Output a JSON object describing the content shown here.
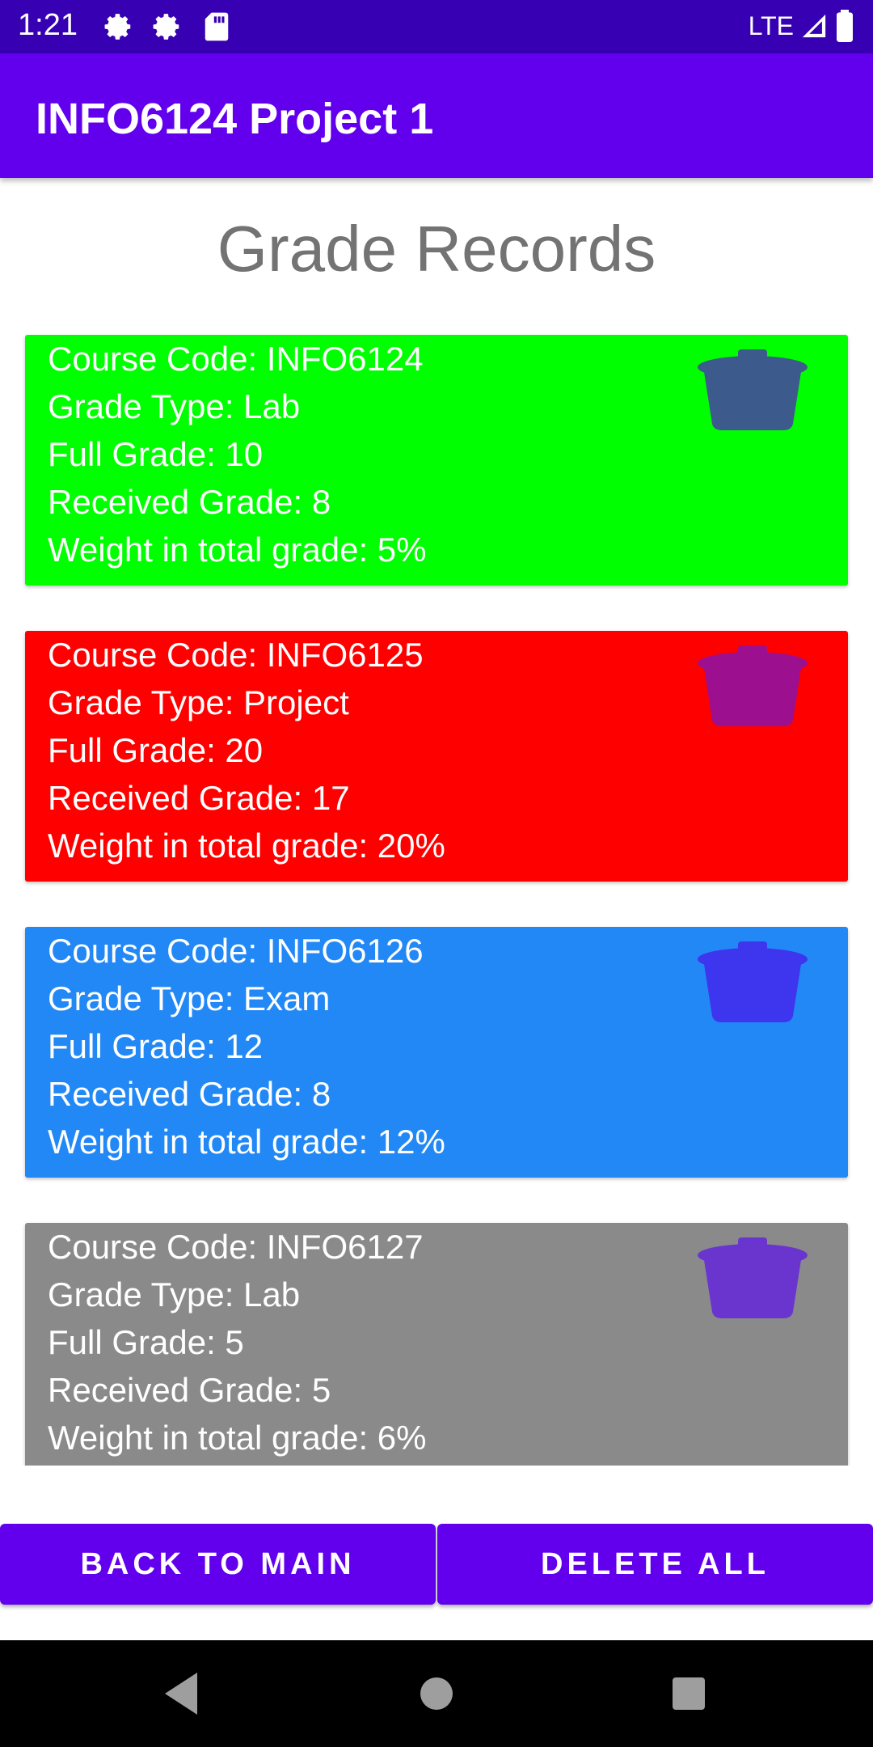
{
  "status_bar": {
    "time": "1:21",
    "network": "LTE"
  },
  "app_bar": {
    "title": "INFO6124 Project 1"
  },
  "page": {
    "title": "Grade Records"
  },
  "labels": {
    "course_code": "Course Code: ",
    "grade_type": "Grade Type: ",
    "full_grade": "Full Grade: ",
    "received_grade": "Received Grade: ",
    "weight": "Weight in total grade: "
  },
  "records": [
    {
      "course_code": "INFO6124",
      "grade_type": "Lab",
      "full_grade": "10",
      "received_grade": "8",
      "weight": "5%",
      "card_color": "#00ff00",
      "trash_color": "#3d5a8c",
      "trash_icon": "trash-icon"
    },
    {
      "course_code": "INFO6125",
      "grade_type": "Project",
      "full_grade": "20",
      "received_grade": "17",
      "weight": "20%",
      "card_color": "#ff0000",
      "trash_color": "#9c0f8f",
      "trash_icon": "trash-icon"
    },
    {
      "course_code": "INFO6126",
      "grade_type": "Exam",
      "full_grade": "12",
      "received_grade": "8",
      "weight": "12%",
      "card_color": "#2288f5",
      "trash_color": "#3e35ee",
      "trash_icon": "trash-icon"
    },
    {
      "course_code": "INFO6127",
      "grade_type": "Lab",
      "full_grade": "5",
      "received_grade": "5",
      "weight": "6%",
      "card_color": "#8a8a8a",
      "trash_color": "#6a35cf",
      "trash_icon": "trash-icon"
    }
  ],
  "buttons": {
    "back": "BACK TO MAIN",
    "delete_all": "DELETE ALL"
  },
  "colors": {
    "status_bar": "#3700b3",
    "primary": "#6200ee",
    "title_gray": "#737373"
  }
}
